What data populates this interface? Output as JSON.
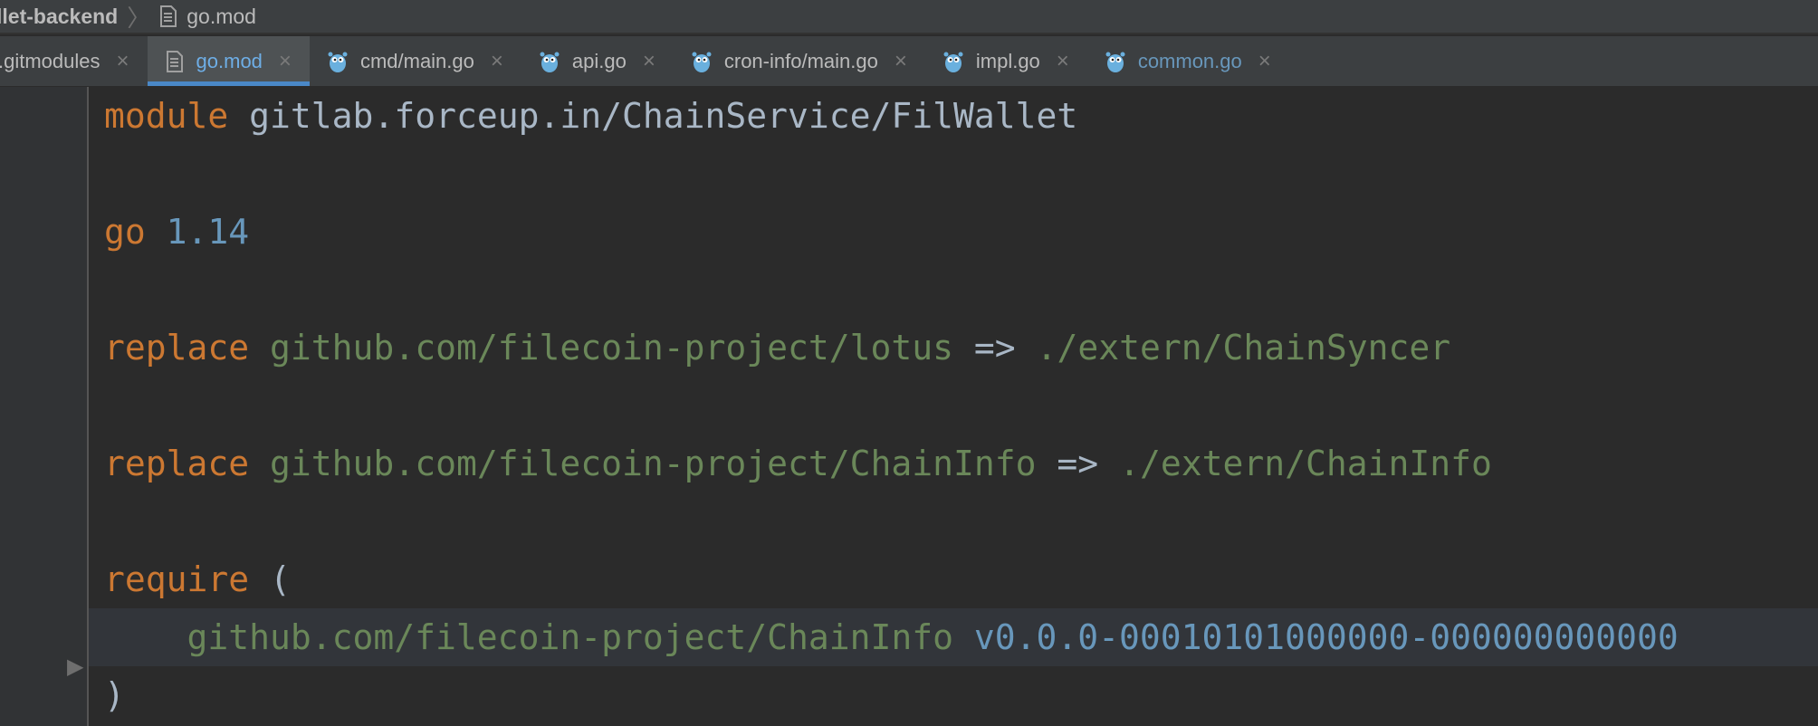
{
  "breadcrumb": {
    "project": "llet-backend",
    "file": "go.mod"
  },
  "tabs": [
    {
      "label": ".gitmodules",
      "icon": "file-icon",
      "state": "normal"
    },
    {
      "label": "go.mod",
      "icon": "file-icon",
      "state": "active"
    },
    {
      "label": "cmd/main.go",
      "icon": "gopher-icon",
      "state": "normal"
    },
    {
      "label": "api.go",
      "icon": "gopher-icon",
      "state": "normal"
    },
    {
      "label": "cron-info/main.go",
      "icon": "gopher-icon",
      "state": "normal"
    },
    {
      "label": "impl.go",
      "icon": "gopher-icon",
      "state": "normal"
    },
    {
      "label": "common.go",
      "icon": "gopher-icon",
      "state": "modified"
    }
  ],
  "close_glyph": "×",
  "code": {
    "line1": {
      "kw": "module",
      "value": "gitlab.forceup.in/ChainService/FilWallet"
    },
    "line2": {
      "kw": "go",
      "value": "1.14"
    },
    "line3": {
      "kw": "replace",
      "from": "github.com/filecoin-project/lotus",
      "arrow": "=>",
      "to": "./extern/ChainSyncer"
    },
    "line4": {
      "kw": "replace",
      "from": "github.com/filecoin-project/ChainInfo",
      "arrow": "=>",
      "to": "./extern/ChainInfo"
    },
    "line5": {
      "kw": "require",
      "open": "("
    },
    "line6": {
      "module": "github.com/filecoin-project/ChainInfo",
      "version": "v0.0.0-00010101000000-000000000000"
    },
    "line7": {
      "close": ")"
    }
  },
  "colors": {
    "keyword": "#cc7832",
    "string": "#6a8759",
    "number": "#6897bb",
    "accent": "#4a88c7"
  }
}
